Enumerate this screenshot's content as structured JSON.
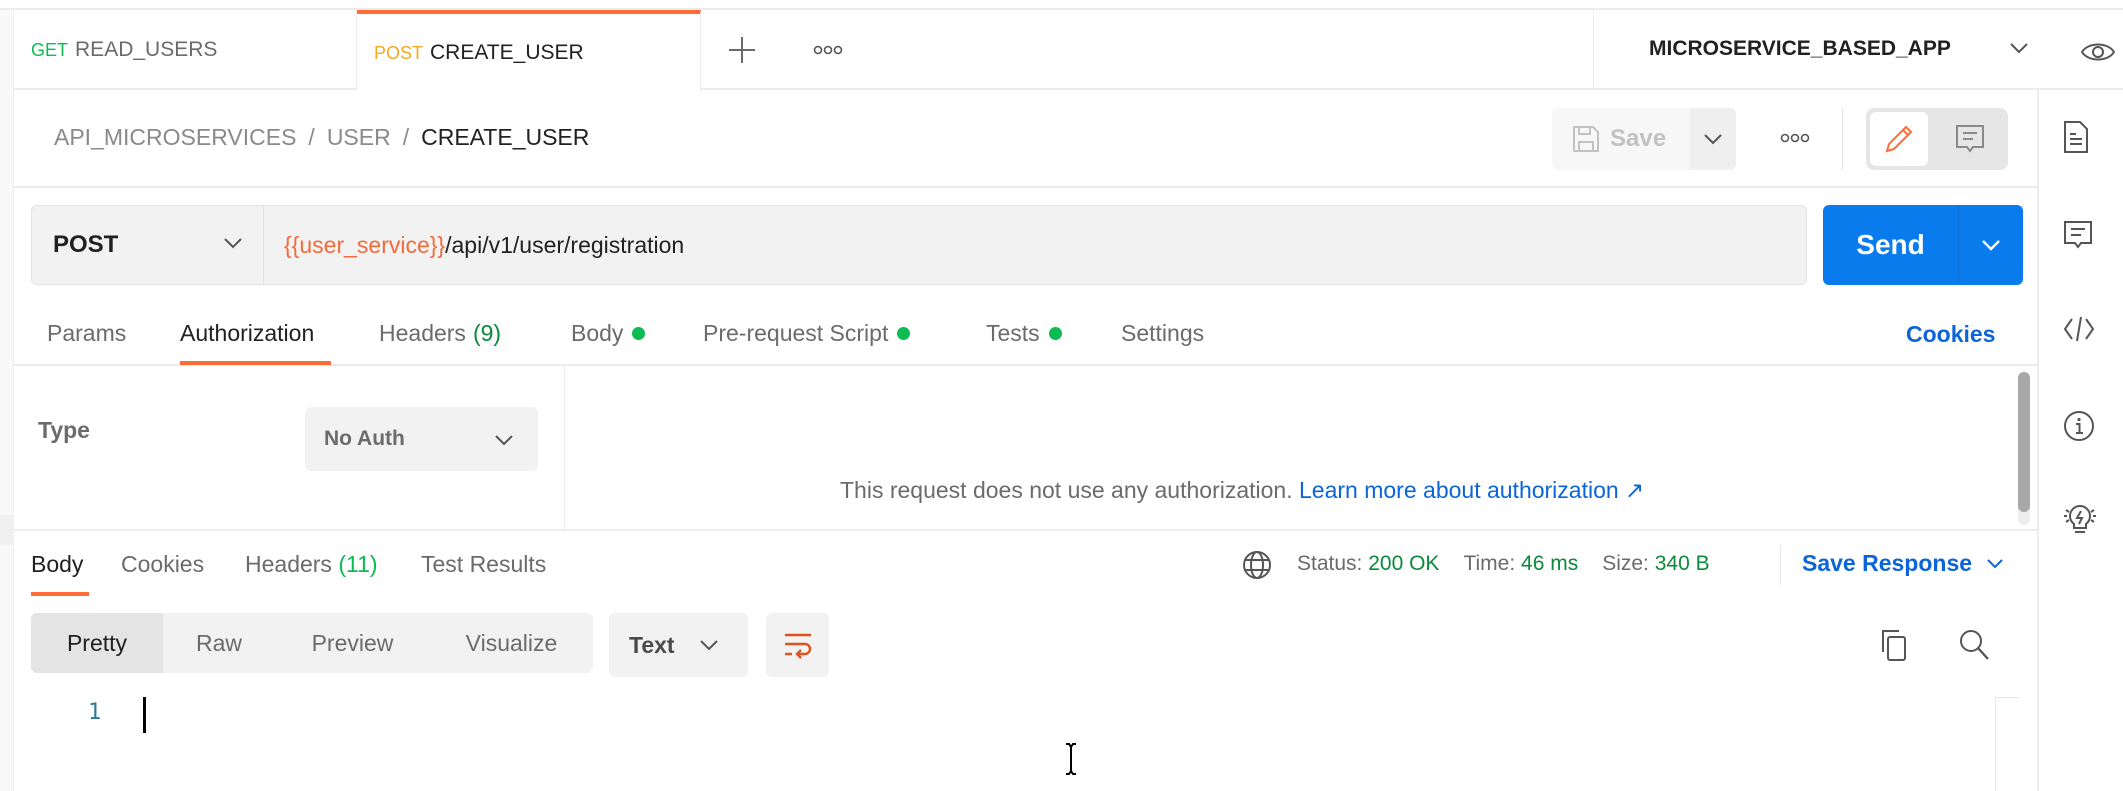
{
  "tabs": [
    {
      "method": "GET",
      "name": "READ_USERS"
    },
    {
      "method": "POST",
      "name": "CREATE_USER"
    }
  ],
  "workspace": {
    "name": "MICROSERVICE_BASED_APP"
  },
  "breadcrumb": {
    "items": [
      "API_MICROSERVICES",
      "USER",
      "CREATE_USER"
    ],
    "separator": "/"
  },
  "toolbar": {
    "save_label": "Save"
  },
  "request": {
    "method": "POST",
    "url_variable": "{{user_service}}",
    "url_path": "/api/v1/user/registration",
    "send_label": "Send"
  },
  "request_tabs": [
    {
      "label": "Params"
    },
    {
      "label": "Authorization"
    },
    {
      "label": "Headers",
      "count": "(9)"
    },
    {
      "label": "Body"
    },
    {
      "label": "Pre-request Script"
    },
    {
      "label": "Tests"
    },
    {
      "label": "Settings"
    }
  ],
  "cookies_label": "Cookies",
  "auth": {
    "type_label": "Type",
    "type_value": "No Auth",
    "message": "This request does not use any authorization.",
    "learn_more": "Learn more about authorization ↗"
  },
  "response_tabs": [
    {
      "label": "Body"
    },
    {
      "label": "Cookies"
    },
    {
      "label": "Headers",
      "count": "(11)"
    },
    {
      "label": "Test Results"
    }
  ],
  "response_status": {
    "status_label": "Status:",
    "status_value": "200 OK",
    "time_label": "Time:",
    "time_value": "46 ms",
    "size_label": "Size:",
    "size_value": "340 B"
  },
  "save_response_label": "Save Response",
  "view_modes": [
    "Pretty",
    "Raw",
    "Preview",
    "Visualize"
  ],
  "format": "Text",
  "editor": {
    "line_number": "1"
  },
  "colors": {
    "accent": "#ff6c37",
    "primary": "#097bed",
    "link": "#0b65d8",
    "success": "#0cbb52",
    "get": "#0cbb52",
    "post": "#f4a91f",
    "variable": "#f26b3a"
  }
}
